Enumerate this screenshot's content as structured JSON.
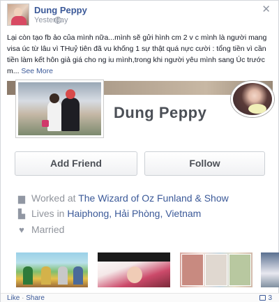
{
  "post": {
    "author": "Dung Peppy",
    "timestamp": "Yesterday",
    "text": "Lại còn tạo fb ảo của mình nữa...mình sẽ gửi hình cm 2 v c mình là người mang visa úc từ lâu vì THuỷ tiên đã vu khống 1 sự thật quá nực cười : tổng tiền vì cần tiền làm kết hôn giả giá cho ng iu mình,trong khi người yêu mình sang Úc trước m...",
    "see_more": "See More"
  },
  "profile": {
    "name": "Dung Peppy",
    "add_friend_label": "Add Friend",
    "follow_label": "Follow",
    "work_prefix": "Worked at",
    "work_place": "The Wizard of Oz Funland & Show",
    "lives_prefix": "Lives in",
    "lives_place": "Haiphong, Hải Phòng, Vietnam",
    "relationship": "Married"
  },
  "footer": {
    "like": "Like",
    "separator": "·",
    "share": "Share",
    "comment_count": "3"
  },
  "colors": {
    "link": "#3b5998",
    "muted": "#9197a3",
    "name_dark": "#4b4f56"
  }
}
